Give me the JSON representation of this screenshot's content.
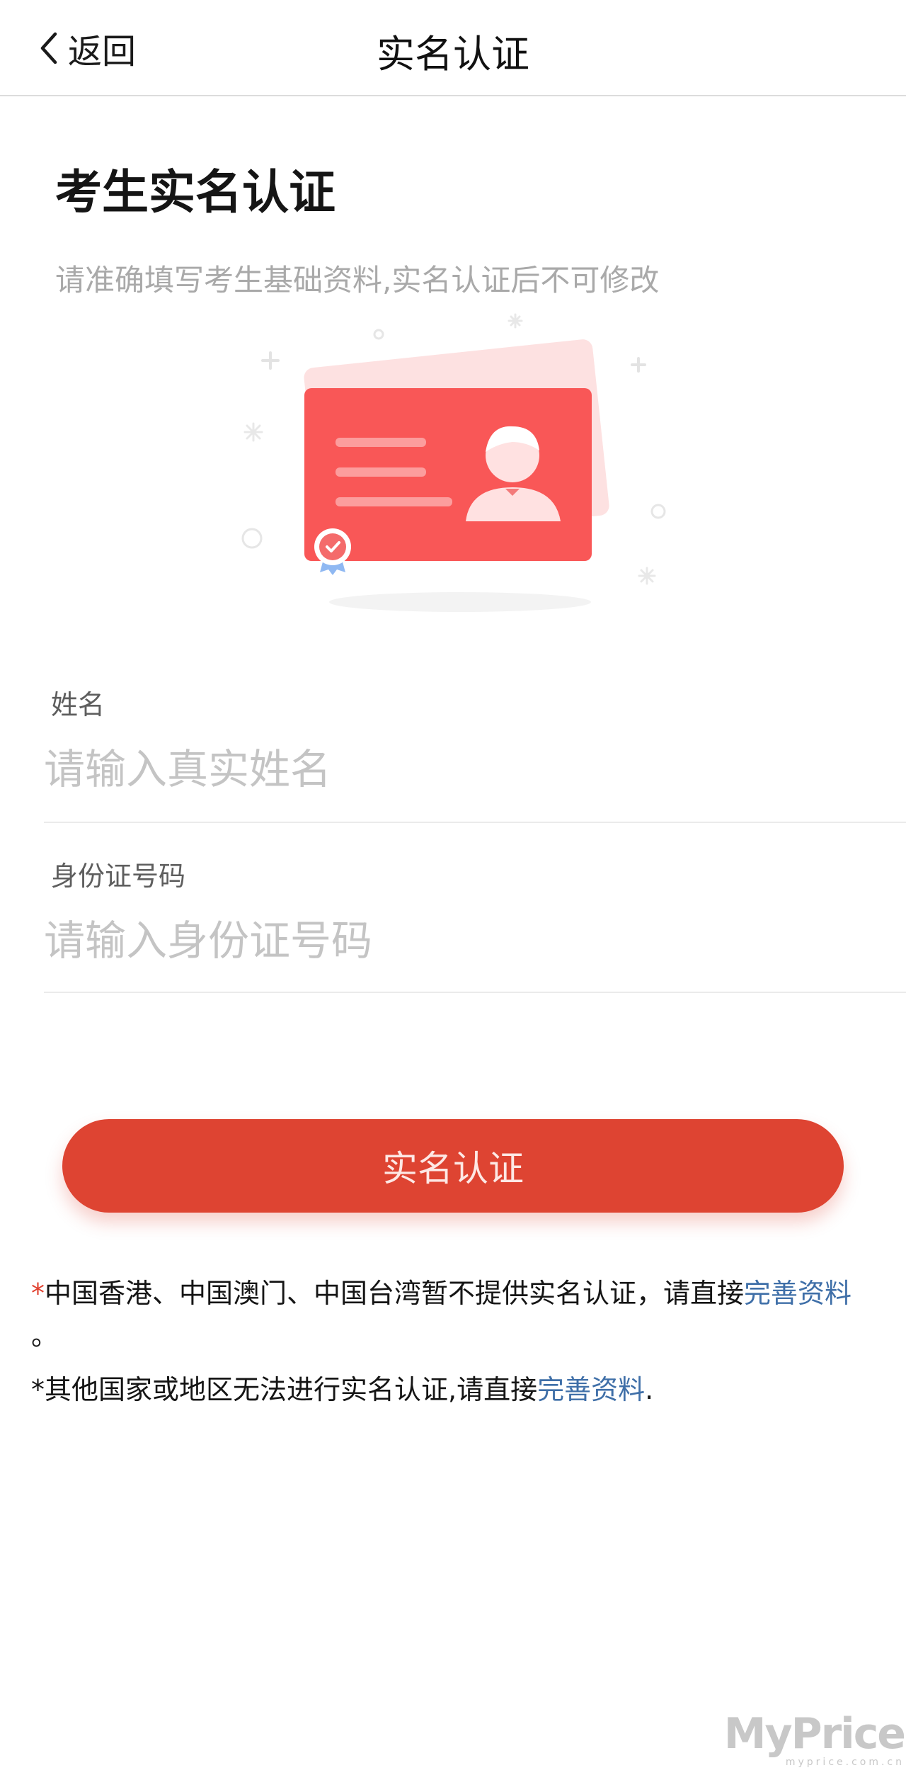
{
  "nav": {
    "back_label": "返回",
    "title": "实名认证"
  },
  "heading": {
    "title": "考生实名认证",
    "subtitle": "请准确填写考生基础资料,实名认证后不可修改"
  },
  "form": {
    "name": {
      "label": "姓名",
      "placeholder": "请输入真实姓名",
      "value": ""
    },
    "id_number": {
      "label": "身份证号码",
      "placeholder": "请输入身份证号码",
      "value": ""
    }
  },
  "submit_label": "实名认证",
  "notes": {
    "note1_star": "*",
    "note1_text": "中国香港、中国澳门、中国台湾暂不提供实名认证，请直接",
    "note1_link": "完善资料",
    "note1_end": "。",
    "note2_text": "*其他国家或地区无法进行实名认证,请直接",
    "note2_link": "完善资料",
    "note2_end": "."
  },
  "watermark": {
    "main": "MyPrice",
    "sub": "myprice.com.cn"
  },
  "colors": {
    "accent": "#de4432",
    "card": "#fa5a5a",
    "link": "#3f6fa8",
    "placeholder": "#c4c4c4"
  },
  "icons": [
    "chevron-left-icon",
    "id-card-icon",
    "badge-check-icon"
  ]
}
